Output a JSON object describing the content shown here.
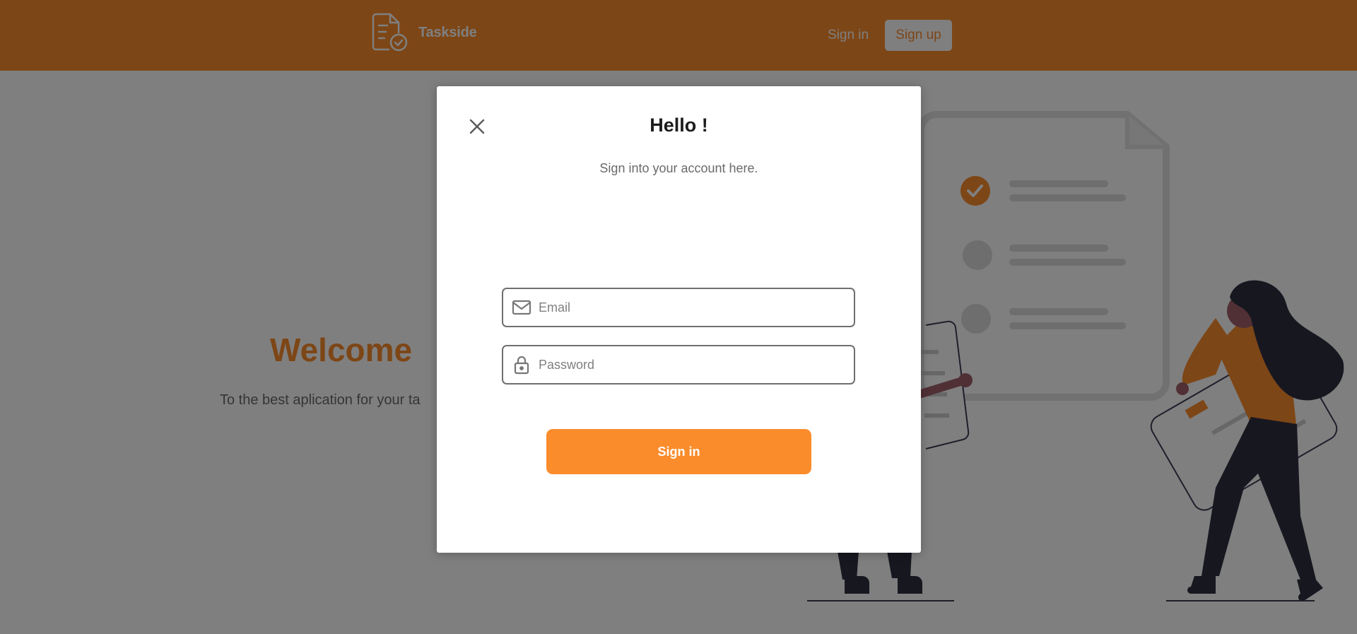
{
  "header": {
    "brand_name": "Taskside",
    "brand_icon": "document-check-icon",
    "signin_label": "Sign in",
    "signup_label": "Sign up"
  },
  "hero": {
    "title": "Welcome",
    "subtitle": "To the best aplication for your ta"
  },
  "modal": {
    "title": "Hello !",
    "subtitle": "Sign into your account here.",
    "close_icon": "close-icon",
    "email_placeholder": "Email",
    "email_icon": "mail-icon",
    "password_placeholder": "Password",
    "password_icon": "lock-icon",
    "submit_label": "Sign in"
  },
  "colors": {
    "brand_orange": "#fb8c2d",
    "overlay": "rgba(0,0,0,0.5)",
    "text_dark": "#1c1c1c"
  }
}
